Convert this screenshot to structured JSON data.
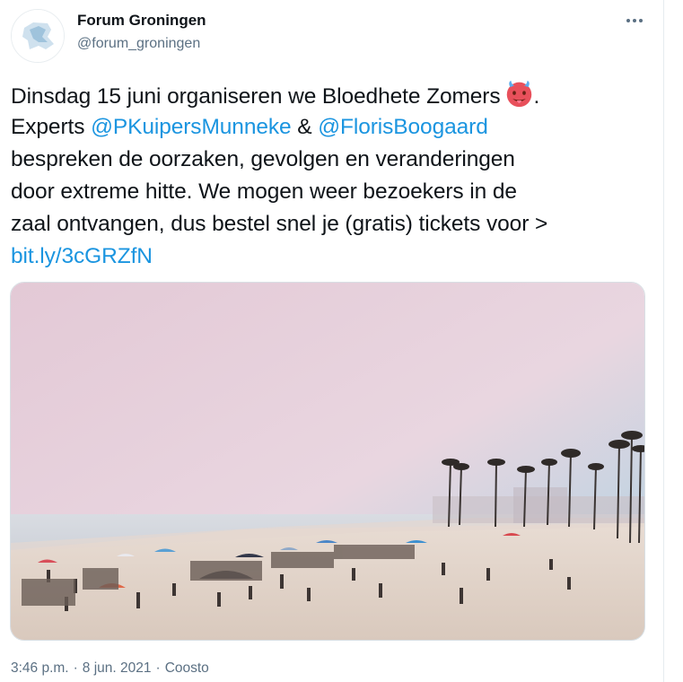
{
  "author": {
    "display_name": "Forum Groningen",
    "handle": "@forum_groningen",
    "avatar_icon": "forum-groningen-logo-icon"
  },
  "more_icon": "more-options-icon",
  "tweet": {
    "line1_text": "Dinsdag 15 juni organiseren we Bloedhete Zomers",
    "line1_end": ".",
    "emoji_icon": "hot-face-emoji-icon",
    "line2_prefix": "Experts ",
    "mention1": "@PKuipersMunneke",
    "line2_and": " & ",
    "mention2": "@FlorisBoogaard",
    "line3": "bespreken de oorzaken, gevolgen en veranderingen",
    "line4": "door extreme hitte. We mogen weer bezoekers in de",
    "line5": "zaal ontvangen, dus bestel snel je (gratis) tickets voor >",
    "link": "bit.ly/3cGRZfN"
  },
  "media": {
    "kind": "photo",
    "subject": "beach-photo"
  },
  "meta": {
    "time": "3:46 p.m.",
    "separator": "·",
    "date": "8 jun. 2021",
    "source": "Coosto"
  },
  "colors": {
    "link": "#1b95e0",
    "secondary_text": "#5b7083",
    "text": "#0f1419"
  }
}
